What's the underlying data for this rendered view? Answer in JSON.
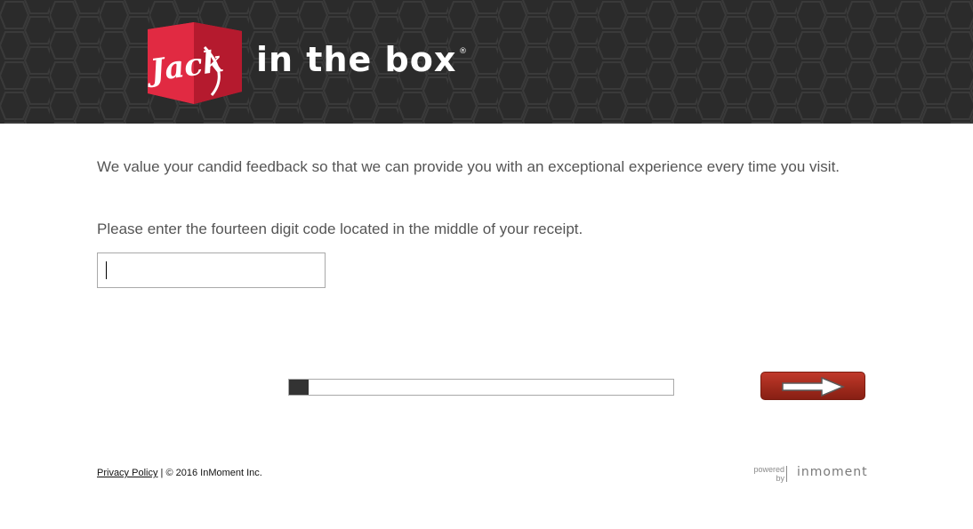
{
  "header": {
    "logo_script": "Jack",
    "logo_wordmark": "in the box",
    "logo_registered": "®",
    "background_color": "#2b2b2b",
    "cube_color": "#d6213a"
  },
  "survey": {
    "intro_text": "We value your candid feedback so that we can provide you with an exceptional experience every time you visit.",
    "prompt_text": "Please enter the fourteen digit code located in the middle of your receipt.",
    "code_input": {
      "value": "",
      "placeholder": ""
    },
    "progress_fraction": 0.05,
    "next_button_icon": "right-arrow-icon",
    "next_button_color": "#a02a1c"
  },
  "footer": {
    "privacy_link": "Privacy Policy",
    "separator": "|",
    "copyright": "© 2016 InMoment Inc.",
    "powered_line1": "powered",
    "powered_line2": "by",
    "brand": "inmoment"
  }
}
